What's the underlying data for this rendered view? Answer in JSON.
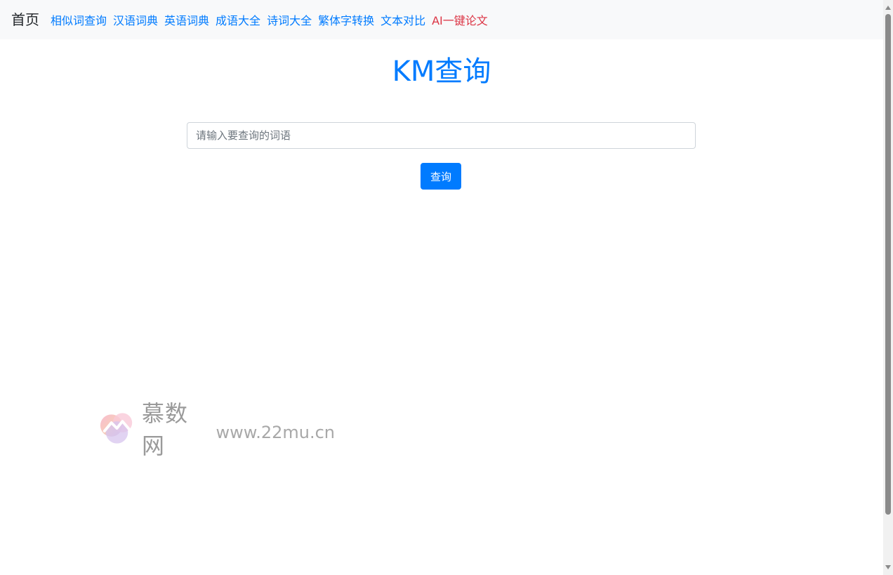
{
  "nav": {
    "brand": "首页",
    "links": [
      {
        "label": "相似词查询"
      },
      {
        "label": "汉语词典"
      },
      {
        "label": "英语词典"
      },
      {
        "label": "成语大全"
      },
      {
        "label": "诗词大全"
      },
      {
        "label": "繁体字转换"
      },
      {
        "label": "文本对比"
      },
      {
        "label": "AI一键论文",
        "highlight": true
      }
    ]
  },
  "main": {
    "title": "KM查询",
    "search_placeholder": "请输入要查询的词语",
    "search_value": "",
    "search_button": "查询"
  },
  "watermark": {
    "name": "慕数网",
    "url": "www.22mu.cn",
    "logo_icon": "cloud-mountain-logo-icon"
  },
  "colors": {
    "accent": "#007bff",
    "highlight": "#dc3545",
    "navbar_bg": "#f8f9fa"
  }
}
